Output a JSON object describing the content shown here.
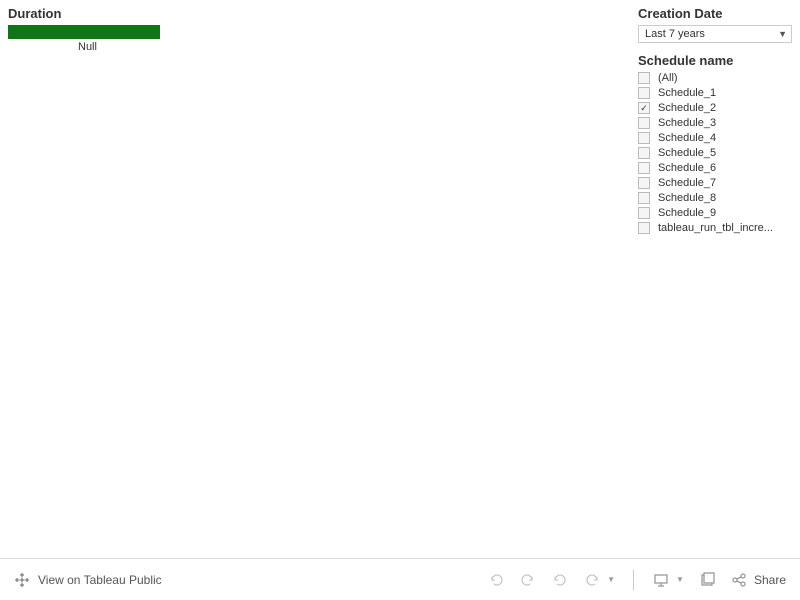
{
  "chart": {
    "title": "Duration",
    "null_label": "Null"
  },
  "chart_data": {
    "type": "bar",
    "categories": [
      "Null"
    ],
    "values": [
      null
    ],
    "title": "Duration",
    "xlabel": "",
    "ylabel": ""
  },
  "filters": {
    "creation_date": {
      "title": "Creation Date",
      "selected": "Last 7 years"
    },
    "schedule_name": {
      "title": "Schedule name",
      "items": [
        {
          "label": "(All)",
          "checked": false
        },
        {
          "label": "Schedule_1",
          "checked": false
        },
        {
          "label": "Schedule_2",
          "checked": true
        },
        {
          "label": "Schedule_3",
          "checked": false
        },
        {
          "label": "Schedule_4",
          "checked": false
        },
        {
          "label": "Schedule_5",
          "checked": false
        },
        {
          "label": "Schedule_6",
          "checked": false
        },
        {
          "label": "Schedule_7",
          "checked": false
        },
        {
          "label": "Schedule_8",
          "checked": false
        },
        {
          "label": "Schedule_9",
          "checked": false
        },
        {
          "label": "tableau_run_tbl_incre...",
          "checked": false
        }
      ]
    }
  },
  "toolbar": {
    "view_label": "View on Tableau Public",
    "share_label": "Share"
  }
}
